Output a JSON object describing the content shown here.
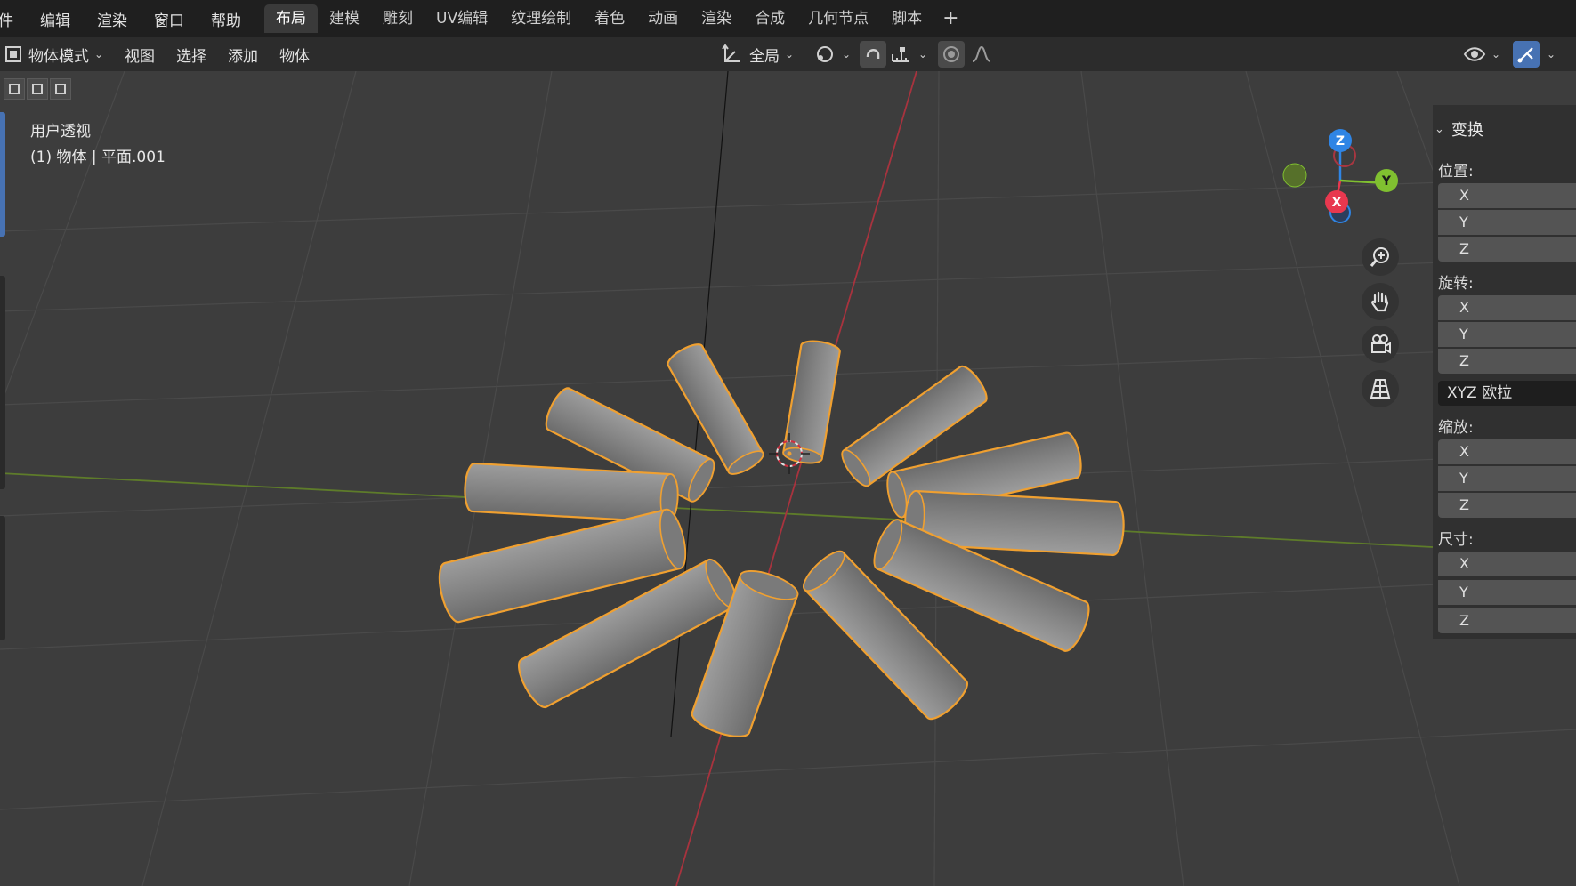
{
  "top_menu": [
    "件",
    "编辑",
    "渲染",
    "窗口",
    "帮助"
  ],
  "workspaces": [
    "布局",
    "建模",
    "雕刻",
    "UV编辑",
    "纹理绘制",
    "着色",
    "动画",
    "渲染",
    "合成",
    "几何节点",
    "脚本"
  ],
  "active_workspace": "布局",
  "add_workspace": "+",
  "header": {
    "mode": "物体模式",
    "menus": [
      "视图",
      "选择",
      "添加",
      "物体"
    ],
    "orientation": "全局"
  },
  "viewport": {
    "view_name": "用户透视",
    "object_info": "(1) 物体 | 平面.001"
  },
  "gizmo": {
    "z": "Z",
    "y": "Y",
    "x": "X"
  },
  "npanel": {
    "section": "变换",
    "location_label": "位置:",
    "rotation_label": "旋转:",
    "rotation_mode": "XYZ 欧拉",
    "scale_label": "缩放:",
    "dimensions_label": "尺寸:",
    "axes": [
      "X",
      "Y",
      "Z"
    ]
  },
  "colors": {
    "selection_outline": "#f0a030",
    "x_axis": "#e8384f",
    "y_axis": "#80c030",
    "z_axis": "#2f85e5",
    "accent": "#4772b3"
  },
  "icons": [
    "zoom-icon",
    "hand-pan-icon",
    "camera-icon",
    "grid-perspective-icon"
  ]
}
